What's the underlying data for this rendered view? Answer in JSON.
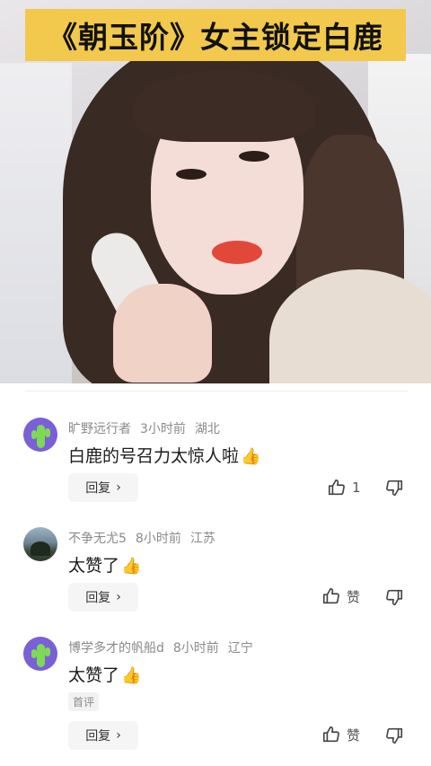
{
  "video": {
    "title": "《朝玉阶》女主锁定白鹿"
  },
  "comments": [
    {
      "username": "旷野远行者",
      "time": "3小时前",
      "location": "湖北",
      "text": "白鹿的号召力太惊人啦",
      "emoji": "👍",
      "reply_label": "回复",
      "like_count": "1",
      "avatar": "cactus-avatar"
    },
    {
      "username": "不争无尤5",
      "time": "8小时前",
      "location": "江苏",
      "text": "太赞了",
      "emoji": "👍",
      "reply_label": "回复",
      "like_label": "赞",
      "avatar": "landscape-photo-avatar"
    },
    {
      "username": "博学多才的帆船d",
      "time": "8小时前",
      "location": "辽宁",
      "text": "太赞了",
      "emoji": "👍",
      "badge": "首评",
      "reply_label": "回复",
      "like_label": "赞",
      "avatar": "cactus-avatar"
    }
  ],
  "colors": {
    "title_bg": "#f2c94c",
    "avatar_bg": "#7b5fd6",
    "cactus": "#7ed957"
  }
}
